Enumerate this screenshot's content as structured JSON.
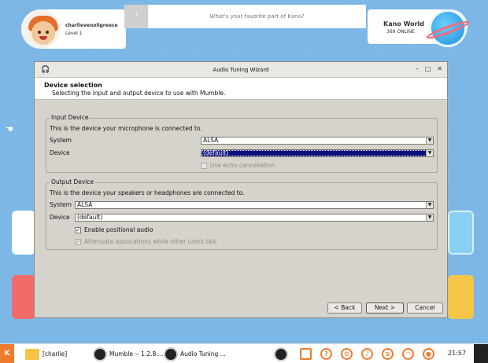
{
  "profile": {
    "username": "charlievenoligreece",
    "level": "Level 1"
  },
  "question": {
    "mark": "?",
    "placeholder": "What's your favorite part of Kano?"
  },
  "world": {
    "title": "Kano World",
    "online": "369 ONLINE"
  },
  "dialog": {
    "title": "Audio Tuning Wizard",
    "window_buttons": {
      "minimize": "–",
      "maximize": "□",
      "close": "✕"
    },
    "header_title": "Device selection",
    "header_subtitle": "Selecting the input and output device to use with Mumble.",
    "input": {
      "legend": "Input Device",
      "description": "This is the device your microphone is connected to.",
      "system_label": "System",
      "system_value": "ALSA",
      "device_label": "Device",
      "device_value": "(default)",
      "echo_label": "Use echo cancellation"
    },
    "output": {
      "legend": "Output Device",
      "description": "This is the device your speakers or headphones are connected to.",
      "system_label": "System",
      "system_value": "ALSA",
      "device_label": "Device",
      "device_value": "(default)",
      "positional_label": "Enable positional audio",
      "attenuate_label": "Attenuate applications while other users talk"
    },
    "buttons": {
      "back": "< Back",
      "next": "Next >",
      "cancel": "Cancel"
    }
  },
  "taskbar": {
    "start_label": "K",
    "tasks": [
      "[charlie]",
      "Mumble -- 1.2.8....",
      "Audio Tuning ..."
    ],
    "clock": "21:57"
  },
  "colors": {
    "desktop": "#5a9fd8",
    "accent": "#f07b2c",
    "selection": "#0b0f7a"
  }
}
